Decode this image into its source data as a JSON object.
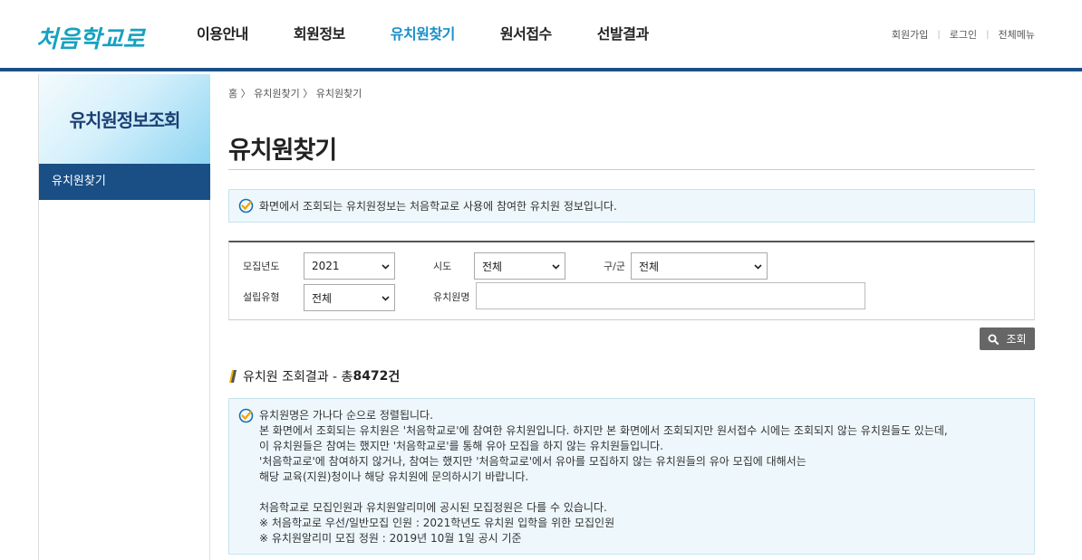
{
  "header": {
    "logo_text": "처음학교로",
    "nav": [
      "이용안내",
      "회원정보",
      "유치원찾기",
      "원서접수",
      "선발결과"
    ],
    "util": [
      "회원가입",
      "로그인",
      "전체메뉴"
    ]
  },
  "sidebar": {
    "title": "유치원정보조회",
    "items": [
      "유치원찾기"
    ]
  },
  "breadcrumb": "홈 〉 유치원찾기 〉 유치원찾기",
  "page_title": "유치원찾기",
  "notice": "화면에서 조회되는 유치원정보는 처음학교로 사용에 참여한 유치원 정보입니다.",
  "search": {
    "year_label": "모집년도",
    "year_value": "2021",
    "sido_label": "시도",
    "sido_value": "전체",
    "gugun_label": "구/군",
    "gugun_value": "전체",
    "type_label": "설립유형",
    "type_value": "전체",
    "name_label": "유치원명",
    "name_value": "",
    "button_label": "조회"
  },
  "result": {
    "prefix": "유치원 조회결과 - 총 ",
    "count": "8472",
    "suffix": "건"
  },
  "info": {
    "lines": [
      "유치원명은 가나다 순으로 정렬됩니다.",
      "본 화면에서 조회되는 유치원은 '처음학교로'에 참여한 유치원입니다. 하지만 본 화면에서 조회되지만 원서접수 시에는 조회되지 않는 유치원들도 있는데,",
      "이 유치원들은 참여는 했지만 '처음학교로'를 통해 유아 모집을 하지 않는 유치원들입니다.",
      "'처음학교로'에 참여하지 않거나, 참여는 했지만 '처음학교로'에서 유아를 모집하지 않는 유치원들의 유아 모집에 대해서는",
      "해당 교육(지원)청이나 해당 유치원에 문의하시기 바랍니다.",
      "처음학교로 모집인원과 유치원알리미에 공시된 모집정원은 다를 수 있습니다.",
      " ※ 처음학교로 우선/일반모집 인원 : 2021학년도 유치원 입학을 위한 모집인원",
      " ※ 유치원알리미 모집 정원 : 2019년 10월 1일 공시 기준"
    ]
  },
  "colors": {
    "primary": "#1a4f86",
    "nav_active": "#1a8fc8",
    "info_bg": "#eef8fc",
    "check": "#f0a500"
  }
}
